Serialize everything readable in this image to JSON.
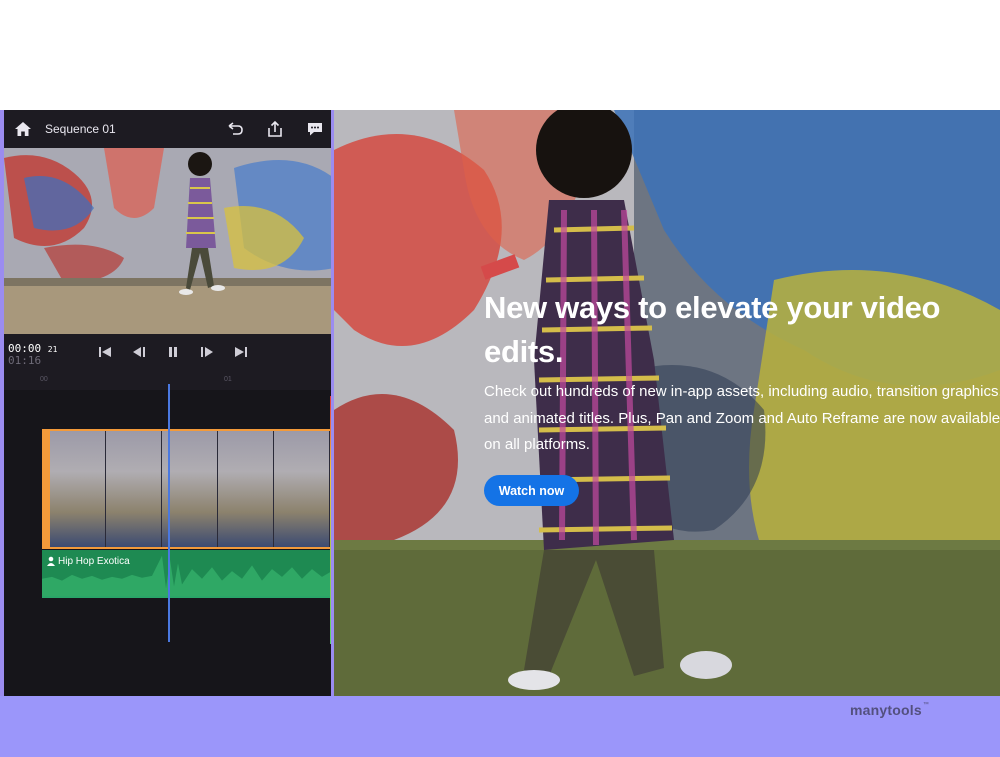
{
  "editor": {
    "sequence_title": "Sequence 01",
    "timecode_current": "00:00",
    "timecode_frames": "21",
    "timecode_total": "01:16",
    "ruler_ticks": [
      "00",
      "01"
    ],
    "audio_track_label": "Hip Hop Exotica"
  },
  "hero": {
    "title": "New ways to elevate your video edits.",
    "body": "Check out hundreds of new in-app assets, including audio, transition graphics, and animated titles. Plus, Pan and Zoom and Auto Reframe are now available on all platforms.",
    "cta_label": "Watch now"
  },
  "footer": {
    "brand": "manytools",
    "brand_mark": "™"
  },
  "colors": {
    "accent_purple": "#9b96fa",
    "cta_blue": "#1473e6",
    "clip_orange": "#f39a3a",
    "audio_green": "#1e8a52",
    "playhead_blue": "#4a78e0"
  }
}
